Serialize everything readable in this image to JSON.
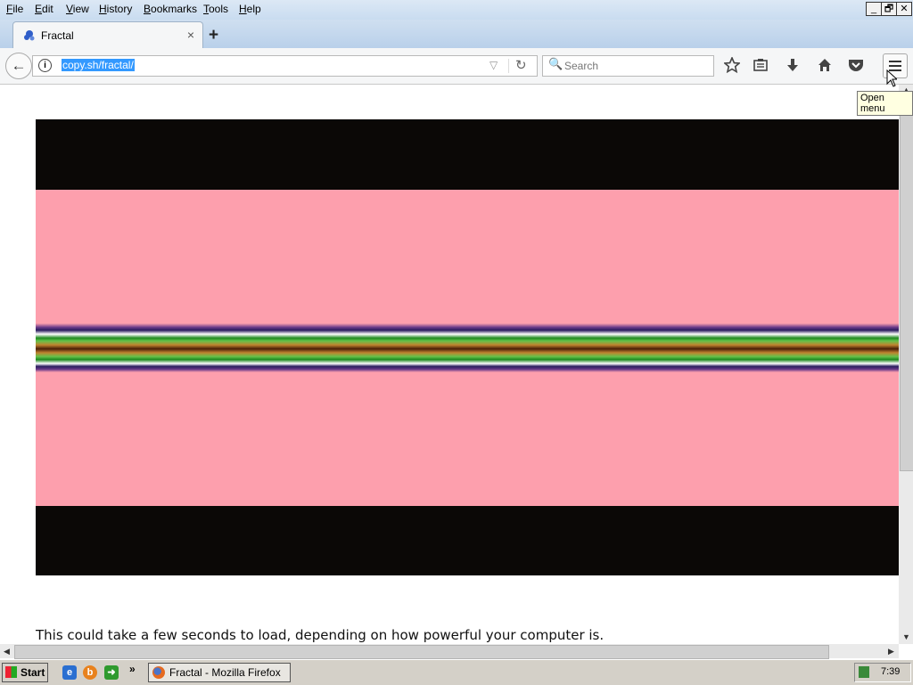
{
  "menubar": {
    "items": [
      "File",
      "Edit",
      "View",
      "History",
      "Bookmarks",
      "Tools",
      "Help"
    ],
    "window_buttons": [
      "_",
      "🗗",
      "✕"
    ]
  },
  "tab": {
    "title": "Fractal",
    "close": "×"
  },
  "newtab": "+",
  "nav": {
    "back": "←",
    "info": "i",
    "url": "copy.sh/fractal/",
    "dropdown": "▽",
    "reload": "↻",
    "search_icon": "🔍",
    "search_placeholder": "Search",
    "toolbar_icons": [
      "bookmark-star-icon",
      "reading-list-icon",
      "download-icon",
      "home-icon",
      "pocket-icon",
      "menu-icon"
    ]
  },
  "tooltip": "Open menu",
  "content": {
    "fractal_colors": {
      "background": "#0b0806",
      "fill": "#fd9fad"
    },
    "load_text": "This could take a few seconds to load, depending on how powerful your computer is."
  },
  "taskbar": {
    "start": "Start",
    "quick_launch": [
      "ie-icon",
      "browser-icon",
      "green-arrow-icon"
    ],
    "more": "»",
    "task": "Fractal - Mozilla Firefox",
    "clock": "7:39"
  }
}
